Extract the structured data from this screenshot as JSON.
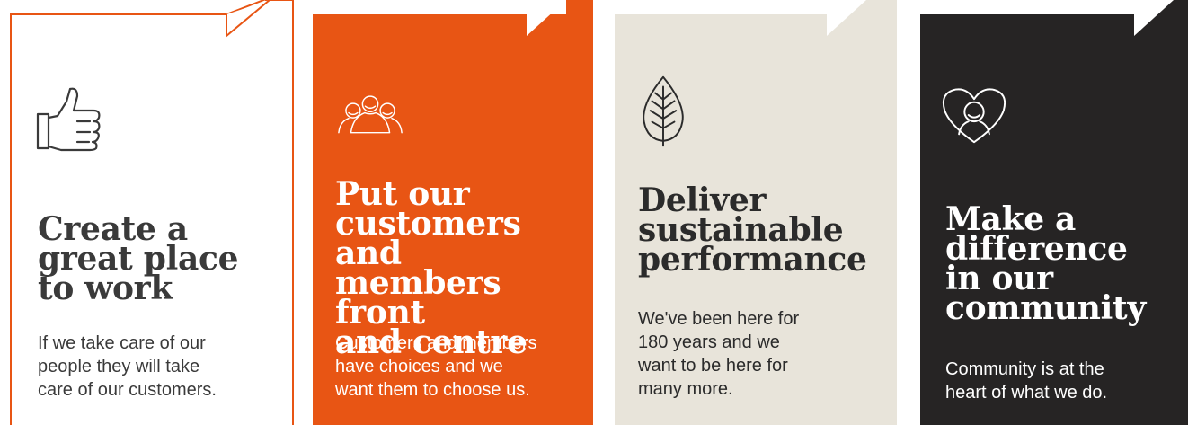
{
  "colors": {
    "orange": "#e85514",
    "beige": "#e8e4da",
    "charcoal": "#262424",
    "text_dark": "#3a3a3a",
    "white": "#ffffff"
  },
  "cards": [
    {
      "icon": "thumbs-up-icon",
      "title": "Create a\ngreat place\nto work",
      "body": "If we take care of our\npeople they will take\ncare of our customers."
    },
    {
      "icon": "group-of-people-icon",
      "title": "Put our\ncustomers and\nmembers front\nand centre",
      "body": "Customers and members\nhave choices and we\nwant them to choose us."
    },
    {
      "icon": "leaf-icon",
      "title": "Deliver\nsustainable\nperformance",
      "body": "We've been here for\n180 years and we\nwant to be here for\nmany more."
    },
    {
      "icon": "heart-person-icon",
      "title": "Make a\ndifference\nin our\ncommunity",
      "body": "Community is at the\nheart of what we do."
    }
  ]
}
